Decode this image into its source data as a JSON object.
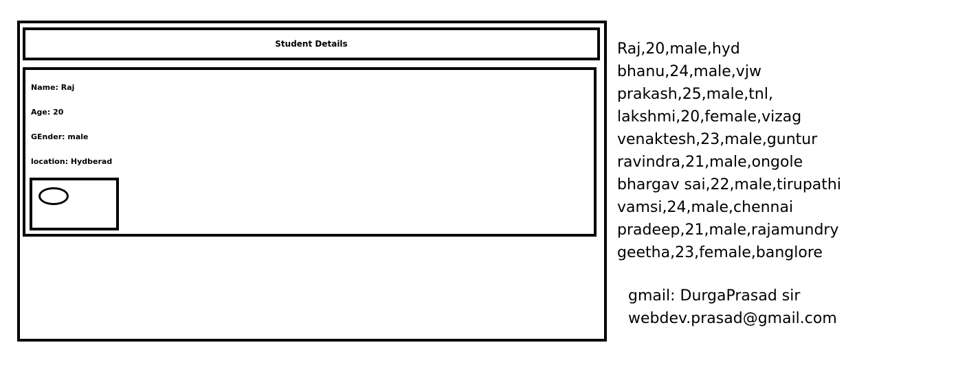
{
  "header": {
    "title": "Student Details"
  },
  "details": {
    "name": "Name: Raj",
    "age": "Age: 20",
    "gender": "GEnder: male",
    "location": "location: Hydberad"
  },
  "records": [
    "Raj,20,male,hyd",
    "bhanu,24,male,vjw",
    "prakash,25,male,tnl,",
    "lakshmi,20,female,vizag",
    "venaktesh,23,male,guntur",
    "ravindra,21,male,ongole",
    "bhargav sai,22,male,tirupathi",
    "vamsi,24,male,chennai",
    "pradeep,21,male,rajamundry",
    "geetha,23,female,banglore"
  ],
  "contact": {
    "line1": "gmail: DurgaPrasad sir",
    "line2": "webdev.prasad@gmail.com"
  }
}
